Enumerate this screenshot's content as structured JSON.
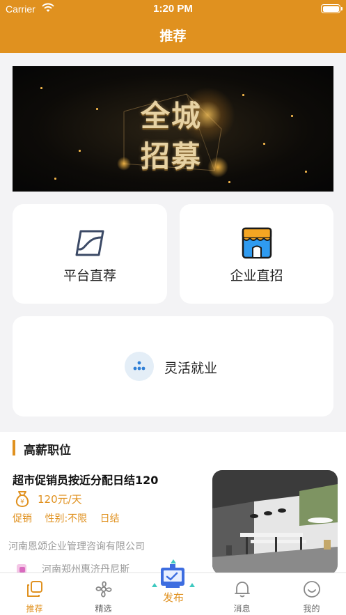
{
  "status_bar": {
    "carrier": "Carrier",
    "time": "1:20 PM"
  },
  "nav": {
    "title": "推荐"
  },
  "banner": {
    "line1": "全城",
    "line2": "招募"
  },
  "quick_entries": {
    "platform": "平台直荐",
    "enterprise": "企业直招",
    "flexible": "灵活就业"
  },
  "high_pay": {
    "section_title": "高薪职位",
    "job": {
      "title": "超市促销员按近分配日结120",
      "salary": "120元/天",
      "tags": [
        "促销",
        "性别:不限",
        "日结"
      ],
      "company": "河南恩颂企业管理咨询有限公司",
      "address": "河南郑州惠济丹尼斯"
    }
  },
  "tabbar": {
    "items": [
      {
        "label": "推荐",
        "active": true
      },
      {
        "label": "精选",
        "active": false
      },
      {
        "label": "发布",
        "active": false
      },
      {
        "label": "消息",
        "active": false
      },
      {
        "label": "我的",
        "active": false
      }
    ]
  },
  "colors": {
    "accent": "#e0911f",
    "background": "#f3f3f5",
    "card": "#ffffff"
  }
}
